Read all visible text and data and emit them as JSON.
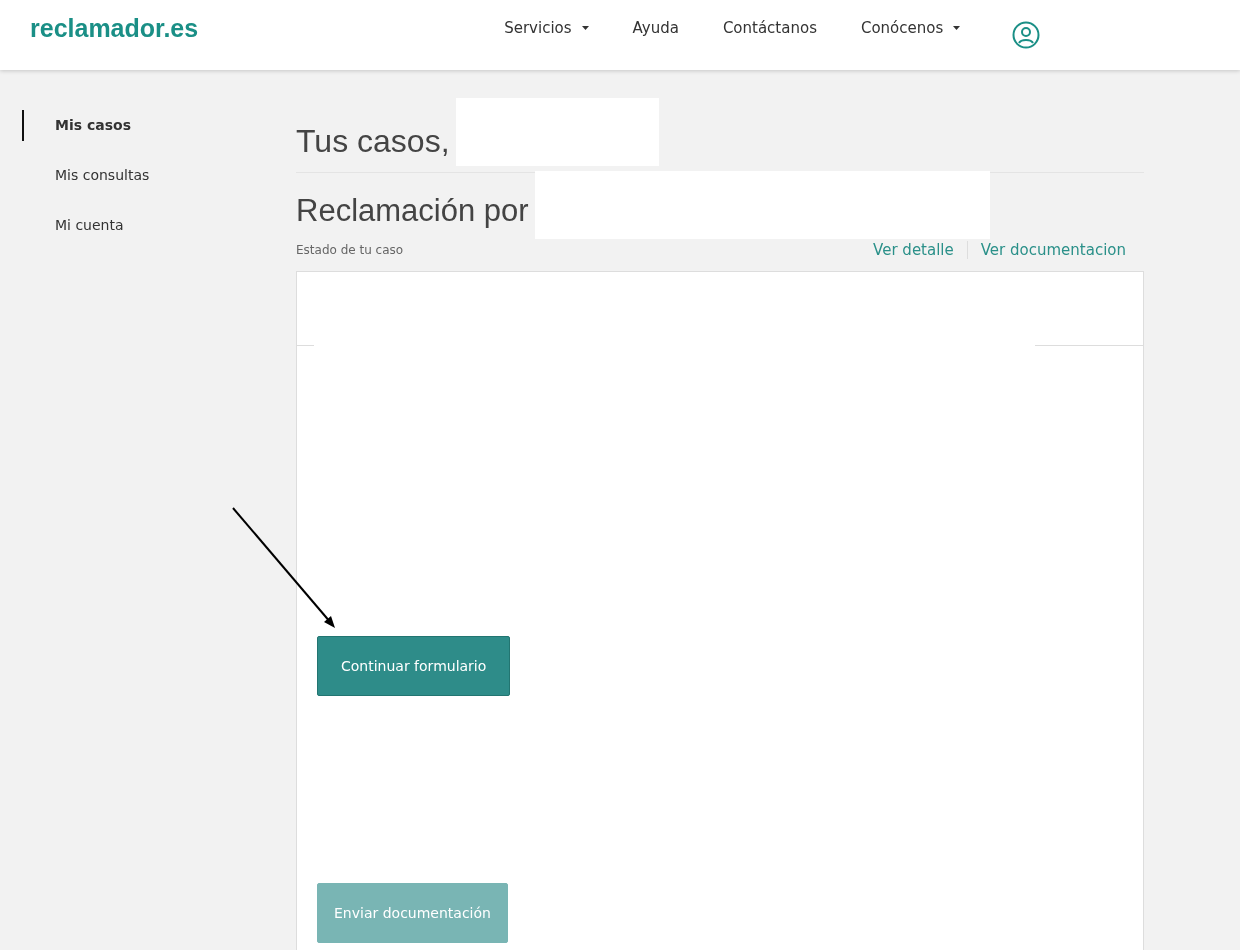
{
  "header": {
    "logo": "reclamador.es",
    "nav": [
      {
        "label": "Servicios",
        "dropdown": true
      },
      {
        "label": "Ayuda",
        "dropdown": false
      },
      {
        "label": "Contáctanos",
        "dropdown": false
      },
      {
        "label": "Conócenos",
        "dropdown": true
      }
    ]
  },
  "sidebar": {
    "items": [
      {
        "label": "Mis casos",
        "selected": true
      },
      {
        "label": "Mis consultas",
        "selected": false
      },
      {
        "label": "Mi cuenta",
        "selected": false
      }
    ]
  },
  "main": {
    "greeting": "Tus casos,",
    "claim_title": "Reclamación por",
    "status_label": "Estado de tu caso",
    "links": [
      "Ver detalle",
      "Ver documentacion"
    ],
    "buttons": [
      {
        "label": "Continuar formulario",
        "disabled": false
      },
      {
        "label": "Enviar documentación",
        "disabled": true
      }
    ]
  }
}
